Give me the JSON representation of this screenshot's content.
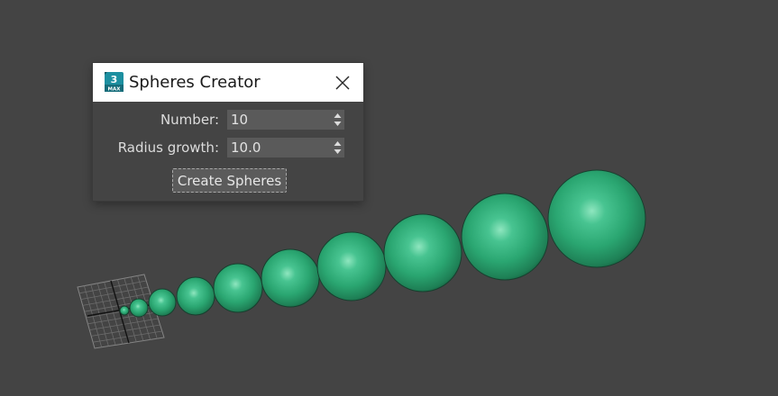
{
  "dialog": {
    "title": "Spheres Creator",
    "app_icon": "3ds-max-app-icon",
    "app_icon_text_top": "3",
    "app_icon_text_bottom": "MAX",
    "close_icon": "close-icon",
    "fields": [
      {
        "label": "Number:",
        "value": "10"
      },
      {
        "label": "Radius growth:",
        "value": "10.0"
      }
    ],
    "create_button_label": "Create Spheres"
  },
  "viewport": {
    "background_color": "#444444",
    "sphere_color": "#2fa673",
    "sphere_count": 10,
    "grid_object": "home-grid-icon"
  }
}
